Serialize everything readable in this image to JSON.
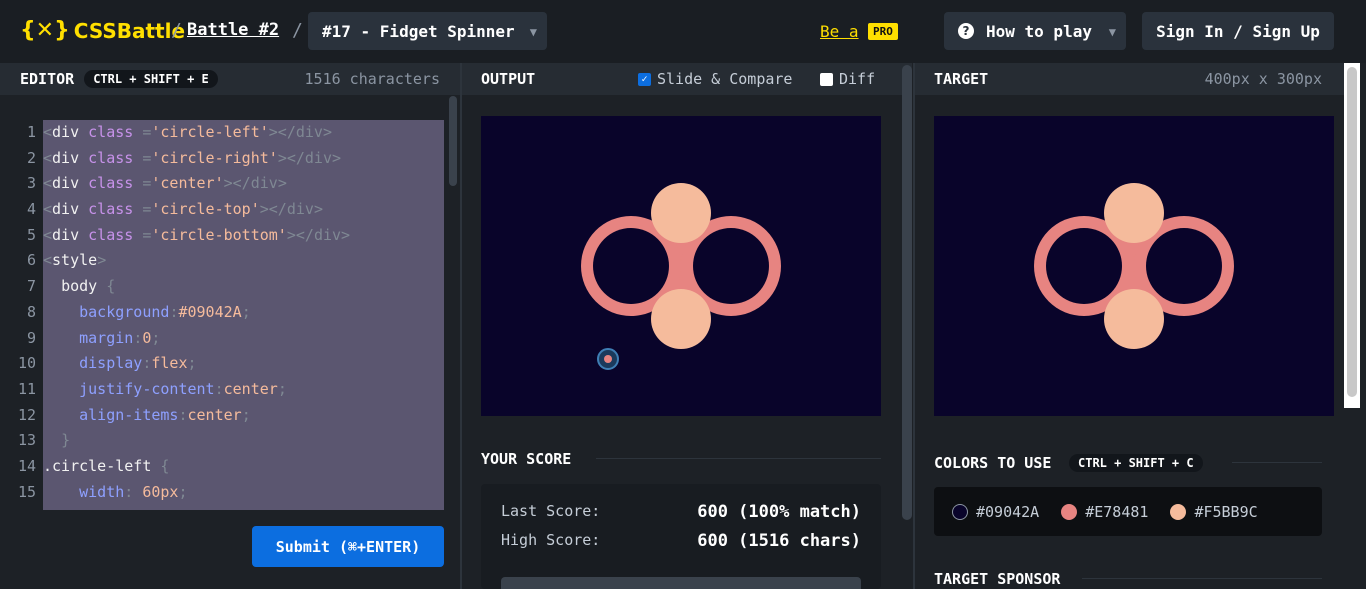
{
  "header": {
    "logo_text": "CSSBattle",
    "logo_braces": "{✕}",
    "sep1": "/",
    "battle_link": "Battle #2",
    "sep2": "/",
    "level_select": "#17 - Fidget Spinner",
    "pro_link": "Be a",
    "pro_badge": "PRO",
    "how_to_play": "How to play",
    "sign_in": "Sign In / Sign Up"
  },
  "editor": {
    "title": "EDITOR",
    "shortcut": "CTRL + SHIFT + E",
    "char_count": "1516 characters",
    "line_numbers": [
      "1",
      "2",
      "3",
      "4",
      "5",
      "6",
      "7",
      "8",
      "9",
      "10",
      "11",
      "12",
      "13",
      "14",
      "15"
    ],
    "submit_label": "Submit (⌘+ENTER)"
  },
  "output": {
    "title": "OUTPUT",
    "slide_compare": "Slide & Compare",
    "slide_compare_checked": true,
    "diff": "Diff",
    "diff_checked": false
  },
  "score": {
    "title": "YOUR SCORE",
    "last_label": "Last Score:",
    "last_value": "600 (100% match)",
    "high_label": "High Score:",
    "high_value": "600 (1516 chars)"
  },
  "target": {
    "title": "TARGET",
    "size": "400px x 300px",
    "colors_title": "COLORS TO USE",
    "colors_shortcut": "CTRL + SHIFT + C",
    "colors": [
      "#09042A",
      "#E78481",
      "#F5BB9C"
    ],
    "sponsor_title": "TARGET SPONSOR"
  },
  "colors": {
    "accent_yellow": "#FFDF00",
    "submit_blue": "#0C6EE0",
    "bg": "#09042A",
    "ring": "#E78481",
    "fill": "#F5BB9C"
  }
}
